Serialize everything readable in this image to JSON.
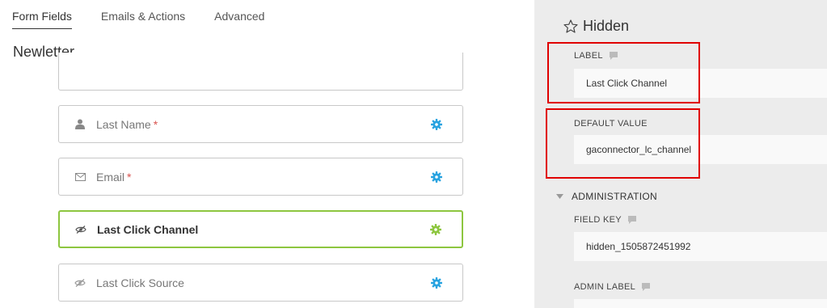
{
  "tabs": [
    {
      "label": "Form Fields",
      "active": true
    },
    {
      "label": "Emails & Actions",
      "active": false
    },
    {
      "label": "Advanced",
      "active": false
    }
  ],
  "form": {
    "title": "Newletter",
    "fields": [
      {
        "label": "Last Name",
        "required": "*",
        "icon": "user-icon"
      },
      {
        "label": "Email",
        "required": "*",
        "icon": "envelope-icon"
      },
      {
        "label": "Last Click Channel",
        "required": "",
        "icon": "eye-slash-icon",
        "selected": true
      },
      {
        "label": "Last Click Source",
        "required": "",
        "icon": "eye-slash-icon"
      }
    ]
  },
  "panel": {
    "title": "Hidden",
    "label_heading": "LABEL",
    "label_value": "Last Click Channel",
    "default_heading": "DEFAULT VALUE",
    "default_value": "gaconnector_lc_channel",
    "admin_section": "ADMINISTRATION",
    "field_key_heading": "FIELD KEY",
    "field_key_value": "hidden_1505872451992",
    "admin_label_heading": "ADMIN LABEL",
    "admin_label_value": ""
  },
  "colors": {
    "gear": "#29a3e0",
    "gear_selected": "#8dc63f",
    "selected_border": "#8dc63f",
    "required": "#d9534f",
    "highlight": "#e00000",
    "panel_bg": "#ececec"
  }
}
